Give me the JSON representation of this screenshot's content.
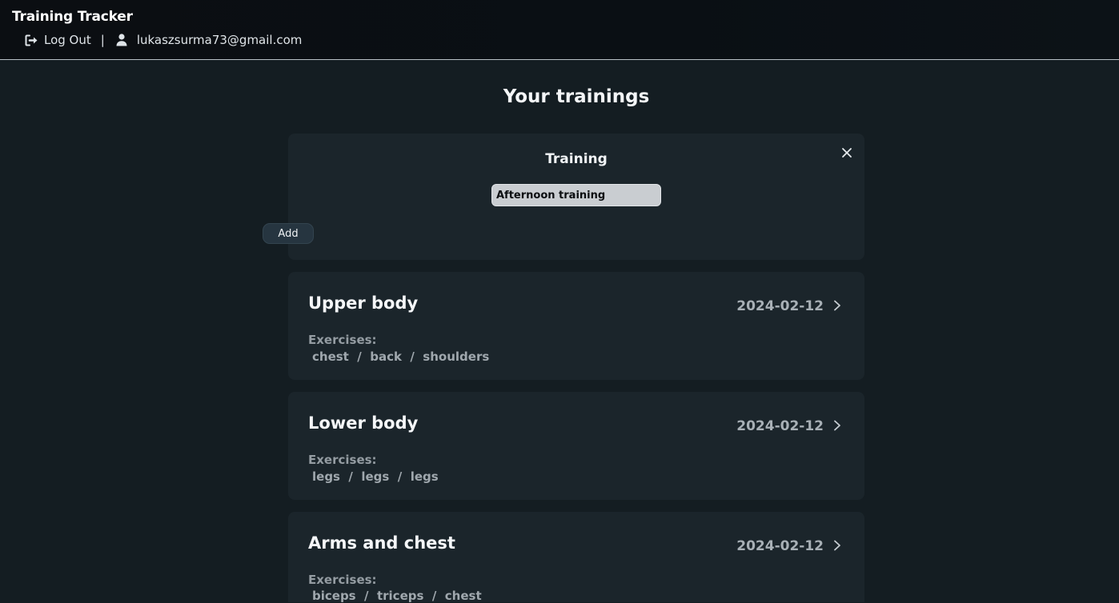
{
  "header": {
    "app_title": "Training Tracker",
    "logout_label": "Log Out",
    "separator": "|",
    "user_email": "lukaszsurma73@gmail.com"
  },
  "page": {
    "title": "Your trainings"
  },
  "form": {
    "title": "Training",
    "name_value": "Afternoon training",
    "add_label": "Add"
  },
  "trainings": [
    {
      "title": "Upper body",
      "date": "2024-02-12",
      "exercises_label": "Exercises:",
      "exercises": [
        "chest",
        "back",
        "shoulders"
      ],
      "exercises_text": "chest  /  back  /  shoulders"
    },
    {
      "title": "Lower body",
      "date": "2024-02-12",
      "exercises_label": "Exercises:",
      "exercises": [
        "legs",
        "legs",
        "legs"
      ],
      "exercises_text": "legs  /  legs  /  legs"
    },
    {
      "title": "Arms and chest",
      "date": "2024-02-12",
      "exercises_label": "Exercises:",
      "exercises": [
        "biceps",
        "triceps",
        "chest"
      ],
      "exercises_text": "biceps  /  triceps  /  chest"
    }
  ],
  "icons": {
    "logout": "logout-icon",
    "user": "user-icon",
    "close": "close-icon",
    "chevron": "chevron-right-icon"
  },
  "colors": {
    "background": "#141d22",
    "panel": "#1b252b",
    "header": "#0a0f14",
    "button": "#263540"
  }
}
